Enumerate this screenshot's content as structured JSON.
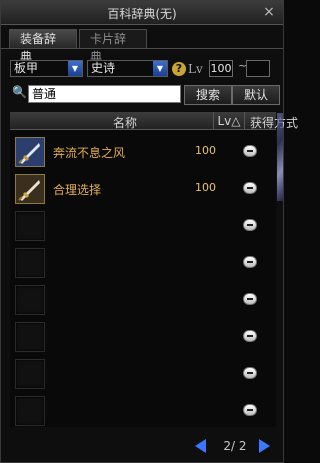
{
  "window": {
    "title": "百科辞典(无)",
    "close_label": "×"
  },
  "tabs": [
    {
      "label": "装备辞典",
      "active": true
    },
    {
      "label": "卡片辞典",
      "active": false
    }
  ],
  "filters": {
    "type": "板甲",
    "rarity": "史诗",
    "help_glyph": "?",
    "lv_label": "Lv",
    "lv_min": "100",
    "tilde": "~",
    "lv_max": ""
  },
  "search": {
    "icon_glyph": "🔍",
    "value": "普通",
    "search_button": "搜索",
    "default_button": "默认"
  },
  "table": {
    "headers": {
      "name": "名称",
      "lv": "Lv△",
      "source": "获得方式"
    },
    "rows": [
      {
        "name": "奔流不息之风",
        "lv": "100",
        "icon": "sword-icon"
      },
      {
        "name": "合理选择",
        "lv": "100",
        "icon": "sword-icon"
      },
      {
        "name": "",
        "lv": ""
      },
      {
        "name": "",
        "lv": ""
      },
      {
        "name": "",
        "lv": ""
      },
      {
        "name": "",
        "lv": ""
      },
      {
        "name": "",
        "lv": ""
      },
      {
        "name": "",
        "lv": ""
      }
    ]
  },
  "pagination": {
    "text": "2/ 2"
  },
  "colors": {
    "item_name": "#e3ad4f",
    "accent_blue": "#3b78ff"
  }
}
